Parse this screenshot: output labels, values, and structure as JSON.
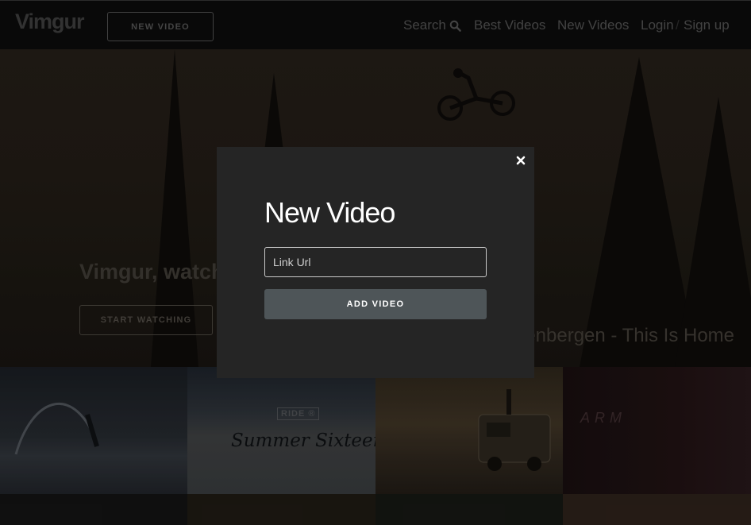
{
  "header": {
    "logo": "Vimgur",
    "new_video_button": "NEW VIDEO",
    "nav": {
      "search": "Search",
      "best_videos": "Best Videos",
      "new_videos": "New Videos",
      "login": "Login",
      "separator": "/",
      "signup": "Sign up"
    }
  },
  "hero": {
    "title": "Vimgur, watch",
    "start_button": "START WATCHING",
    "caption": "eenbergen - This Is Home"
  },
  "tiles": {
    "ride_badge": "RIDE ®",
    "summer_text": "Summer Sixteen",
    "arm_text": "ARM"
  },
  "modal": {
    "title": "New Video",
    "input_placeholder": "Link Url",
    "input_value": "",
    "submit_label": "ADD VIDEO"
  },
  "icons": {
    "search": "search-icon",
    "close": "close-icon"
  },
  "colors": {
    "modal_background": "#252525",
    "submit_background": "#4e5558",
    "input_border": "#c9c9c9"
  }
}
